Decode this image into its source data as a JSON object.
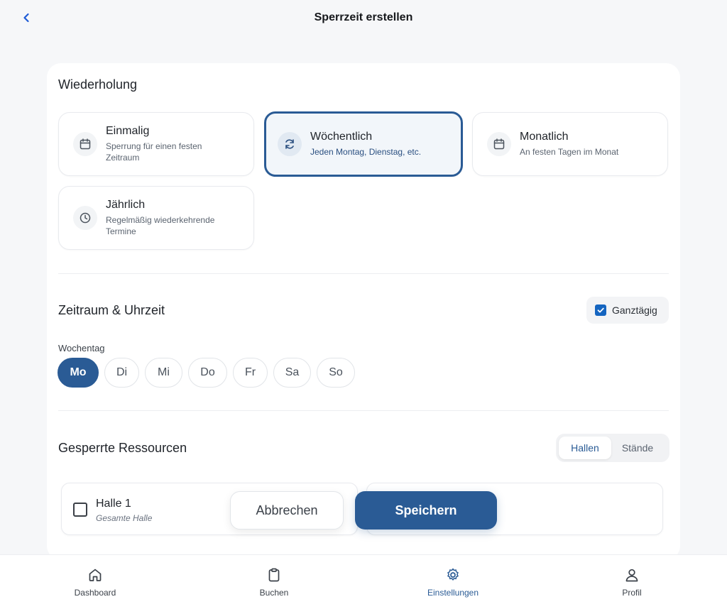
{
  "header": {
    "title": "Sperrzeit erstellen"
  },
  "repeat": {
    "title": "Wiederholung",
    "options": [
      {
        "title": "Einmalig",
        "desc": "Sperrung für einen festen Zeitraum",
        "icon": "calendar-icon"
      },
      {
        "title": "Wöchentlich",
        "desc": "Jeden Montag, Dienstag, etc.",
        "icon": "refresh-icon",
        "selected": true
      },
      {
        "title": "Monatlich",
        "desc": "An festen Tagen im Monat",
        "icon": "calendar-icon"
      },
      {
        "title": "Jährlich",
        "desc": "Regelmäßig wiederkehrende Termine",
        "icon": "clock-icon"
      }
    ]
  },
  "time": {
    "title": "Zeitraum & Uhrzeit",
    "all_day_label": "Ganztägig",
    "all_day_checked": true,
    "weekday_label": "Wochentag",
    "weekdays": [
      "Mo",
      "Di",
      "Mi",
      "Do",
      "Fr",
      "Sa",
      "So"
    ],
    "selected_weekday": "Mo"
  },
  "resources": {
    "title": "Gesperrte Ressourcen",
    "tabs": [
      "Hallen",
      "Stände"
    ],
    "active_tab": "Hallen",
    "items": [
      {
        "title": "Halle 1",
        "sub": "Gesamte Halle"
      }
    ]
  },
  "actions": {
    "cancel": "Abbrechen",
    "save": "Speichern"
  },
  "tabbar": {
    "items": [
      {
        "label": "Dashboard",
        "icon": "home-icon"
      },
      {
        "label": "Buchen",
        "icon": "clipboard-icon"
      },
      {
        "label": "Einstellungen",
        "icon": "gear-icon",
        "active": true
      },
      {
        "label": "Profil",
        "icon": "user-icon"
      }
    ]
  },
  "colors": {
    "primary": "#2a5b95",
    "checkbox": "#1565c0",
    "back": "#1e5bd6"
  }
}
